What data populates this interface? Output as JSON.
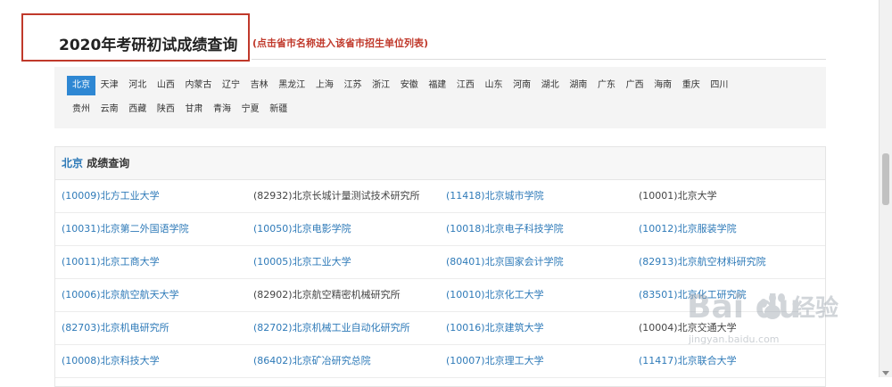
{
  "header": {
    "title": "2020年考研初试成绩查询",
    "subtitle": "(点击省市名称进入该省市招生单位列表)"
  },
  "provinces": {
    "active": "北京",
    "row1": [
      "北京",
      "天津",
      "河北",
      "山西",
      "内蒙古",
      "辽宁",
      "吉林",
      "黑龙江",
      "上海",
      "江苏",
      "浙江",
      "安徽",
      "福建",
      "江西",
      "山东",
      "河南",
      "湖北",
      "湖南",
      "广东",
      "广西",
      "海南",
      "重庆",
      "四川"
    ],
    "row2": [
      "贵州",
      "云南",
      "西藏",
      "陕西",
      "甘肃",
      "青海",
      "宁夏",
      "新疆"
    ]
  },
  "panel": {
    "province": "北京",
    "heading_rest": " 成绩查询"
  },
  "schools": [
    [
      "(10009)北方工业大学",
      "(82932)北京长城计量测试技术研究所",
      "(11418)北京城市学院",
      "(10001)北京大学"
    ],
    [
      "(10031)北京第二外国语学院",
      "(10050)北京电影学院",
      "(10018)北京电子科技学院",
      "(10012)北京服装学院"
    ],
    [
      "(10011)北京工商大学",
      "(10005)北京工业大学",
      "(80401)北京国家会计学院",
      "(82913)北京航空材料研究院"
    ],
    [
      "(10006)北京航空航天大学",
      "(82902)北京航空精密机械研究所",
      "(10010)北京化工大学",
      "(83501)北京化工研究院"
    ],
    [
      "(82703)北京机电研究所",
      "(82702)北京机械工业自动化研究所",
      "(10016)北京建筑大学",
      "(10004)北京交通大学"
    ],
    [
      "(10008)北京科技大学",
      "(86402)北京矿冶研究总院",
      "(10007)北京理工大学",
      "(11417)北京联合大学"
    ]
  ],
  "school_link_colors": {
    "link": "#2e7ab8",
    "plain": "#444444"
  },
  "watermark": {
    "brand": "Bai du",
    "cn": "经验",
    "url": "jingyan.baidu.com"
  },
  "colors": {
    "accent": "#2e87d3",
    "title_border": "#c0392b"
  }
}
